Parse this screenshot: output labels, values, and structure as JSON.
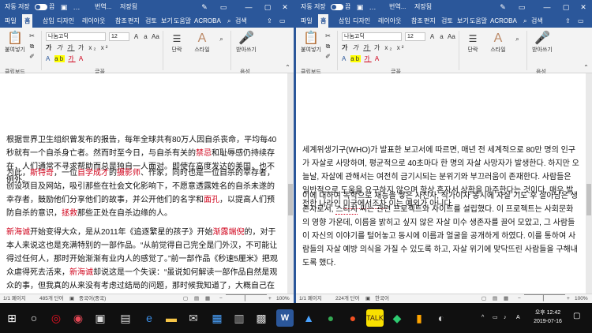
{
  "windows": [
    {
      "autosave": "자동 저장",
      "autosave_state": "끔",
      "title": "번역...",
      "saved": "저장됨",
      "tabs": [
        "파일",
        "홈",
        "삽입",
        "디자인",
        "레이아웃",
        "참조",
        "편지",
        "검토",
        "보기",
        "도움말",
        "ACROBA"
      ],
      "search_label": "검색",
      "clipboard": {
        "paste": "붙여넣기",
        "group": "클립보드"
      },
      "font": {
        "name": "나눔고딕",
        "size": "12",
        "group": "글꼴"
      },
      "paragraph": {
        "label": "단락"
      },
      "styles": {
        "label": "스타일"
      },
      "dictate": {
        "label": "받아쓰기",
        "group": "음성"
      },
      "paragraphs": [
        [
          {
            "t": "根据世界卫生组织曾发布的报告，每年全球共有80万人因自杀丧命，平均每40秒就有一个自杀身亡者。然而时至今日，与自杀有关的"
          },
          {
            "t": "禁忌",
            "c": "red"
          },
          {
            "t": "和耻辱感仍持续存在，人们通常不寻求帮助而总是独自一人面对。即使在高度发达的美国，也不例外。"
          }
        ],
        [
          {
            "t": "为此，"
          },
          {
            "t": "斯特奇",
            "c": "red"
          },
          {
            "t": "，一位"
          },
          {
            "t": "自学成才",
            "c": "red"
          },
          {
            "t": "的"
          },
          {
            "t": "摄影师",
            "c": "red"
          },
          {
            "t": "、作家，同时也是一位自杀的幸存者，创设项目及网站，吸引那些在社会文化影响下，不愿意透露姓名的自杀未遂的幸存者，鼓励他们分享他们的故事，并公开他们的名字和"
          },
          {
            "t": "面孔",
            "c": "red"
          },
          {
            "t": "，以提高人们预防自杀的意识，"
          },
          {
            "t": "拯救",
            "c": "red"
          },
          {
            "t": "那些正处在自杀边缘的人。"
          }
        ],
        [
          {
            "t": "新海诚",
            "c": "red"
          },
          {
            "t": "开始变得大众，是从2011年《追逐繁星的孩子》开始"
          },
          {
            "t": "渐露端倪",
            "c": "red"
          },
          {
            "t": "的，对于本人来说这也是充满特别的一部作品。“从前觉得自己完全是门外汉，不可能让得过任何人，那时开始渐渐有业内人的感觉了。”前一部作品《秒速5厘米》把观众虐得死去活来，"
          },
          {
            "t": "新海诚",
            "c": "red"
          },
          {
            "t": "却说这是一个失误：“虽说如何解读一部作品自然是观众的事，但我真的从来没有考虑过结局的问题，那时候我知道了，大概自己在技术上存在失误吧。”这也"
          },
          {
            "t": "许",
            "c": "red"
          },
          {
            "t": "是为什么，在拍摄了那么多因为「物理障碍」、「生离死别」和「年龄差」而导致的"
          }
        ]
      ],
      "status": {
        "page": "1/1 페이지",
        "words": "485개 단어",
        "lang": "중국어(중국)",
        "zoom": "100%"
      }
    },
    {
      "autosave": "자동 저장",
      "autosave_state": "끔",
      "title": "번역...",
      "saved": "저장됨",
      "tabs": [
        "파일",
        "홈",
        "삽입",
        "디자인",
        "레이아웃",
        "참조",
        "편지",
        "검토",
        "보기",
        "도움말",
        "ACROBA"
      ],
      "search_label": "검색",
      "clipboard": {
        "paste": "붙여넣기",
        "group": "클립보드"
      },
      "font": {
        "name": "나눔고딕",
        "size": "12",
        "group": "글꼴"
      },
      "paragraph": {
        "label": "단락"
      },
      "styles": {
        "label": "스타일"
      },
      "dictate": {
        "label": "받아쓰기",
        "group": "음성"
      },
      "paragraphs": [
        [
          {
            "t": "세계위생기구(WHO)가 발표한 보고서에 따르면, 매년 전 세계적으로 80만 명의 인구가 자살로 사망하며, 평균적으로 40초마다 한 명의 자살 사망자가 발생한다. 하지만 오늘날, 자살에 관해서는 여전히 금기시되는 분위기와 부끄러움이 존재한다. 사람들은 일반적으로 도움을 요구하지 않으며 항상 혼자서 상황을 마주한다는 것이다. 매우 발전한 나라인 "
          },
          {
            "t": "미국에서조차",
            "c": "sq"
          },
          {
            "t": " 이는 예외가 아니다."
          }
        ],
        [
          {
            "t": "이에 대하여 독학으로 재능을 쌓은 사진사, 작가이자 동시에 자살 기도 후 살아남은 생존자로서, "
          },
          {
            "t": "스티치",
            "c": "sq"
          },
          {
            "t": " 씨는 관련 프로젝트와 사이트를 설립했다. 이 프로젝트는 사회문화의 영향 가운데, 이름을 밝히고 싶지 않은 자살 미수 생존자를 끌어 모았고, 그 사람들이 자신의 이야기를 털어놓고 동시에 이름과 얼굴을 공개하게 하였다. 이를 통하여 사람들의 자살 예방 의식을 가질 수 있도록 하고, 자살 위기에 맞닥뜨린 사람들을 구해내도록 했다."
          }
        ]
      ],
      "status": {
        "page": "1/1 페이지",
        "words": "224개 단어",
        "lang": "한국어",
        "zoom": "100%"
      }
    }
  ],
  "icons": {
    "save": "save-icon",
    "share": "share-icon",
    "comment": "comment-icon",
    "minimize": "minimize-icon",
    "maximize": "maximize-icon",
    "close": "close-icon",
    "search": "search-icon",
    "mic": "microphone-icon"
  },
  "taskbar": {
    "apps": [
      "start-icon",
      "search-icon",
      "cortana-icon",
      "app-icon",
      "photos-icon",
      "taskview-icon",
      "edge-icon",
      "explorer-icon",
      "mail-icon",
      "store-icon",
      "word-icon",
      "kakao-icon",
      "chrome-icon",
      "talk-icon",
      "app2-icon",
      "app3-icon",
      "app4-icon"
    ],
    "time": "오후 12:42",
    "date": "2019-07-16",
    "ime": "A",
    "notif": "4"
  },
  "colors": {
    "word_blue": "#2b579a",
    "red_text": "#d0021b",
    "taskbar": "#101010"
  }
}
